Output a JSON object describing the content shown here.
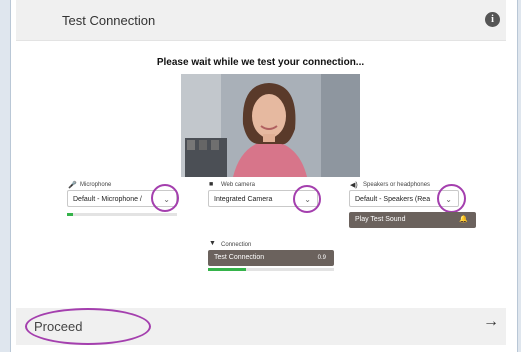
{
  "header": {
    "title": "Test Connection",
    "info_icon": "i"
  },
  "main": {
    "heading": "Please wait while we test your connection...",
    "microphone": {
      "label": "Microphone",
      "value": "Default - Microphone /",
      "level": 0.05
    },
    "camera": {
      "label": "Web camera",
      "value": "Integrated Camera"
    },
    "speakers": {
      "label": "Speakers or headphones",
      "value": "Default - Speakers (Rea",
      "test_button": "Play Test Sound"
    },
    "connection": {
      "label": "Connection",
      "button": "Test Connection",
      "button_suffix": "0.9",
      "progress": 0.3
    }
  },
  "footer": {
    "proceed_label": "Proceed",
    "arrow": "→"
  },
  "icons": {
    "mic": "microphone-icon",
    "camera": "video-camera-icon",
    "speaker": "speaker-icon",
    "wifi": "wifi-icon",
    "bell": "bell-icon",
    "info": "info-icon",
    "chevron": "chevron-down-icon"
  },
  "colors": {
    "accent_ring": "#a43fae",
    "meter_green": "#35b34a",
    "dark_button": "#6b625d"
  }
}
